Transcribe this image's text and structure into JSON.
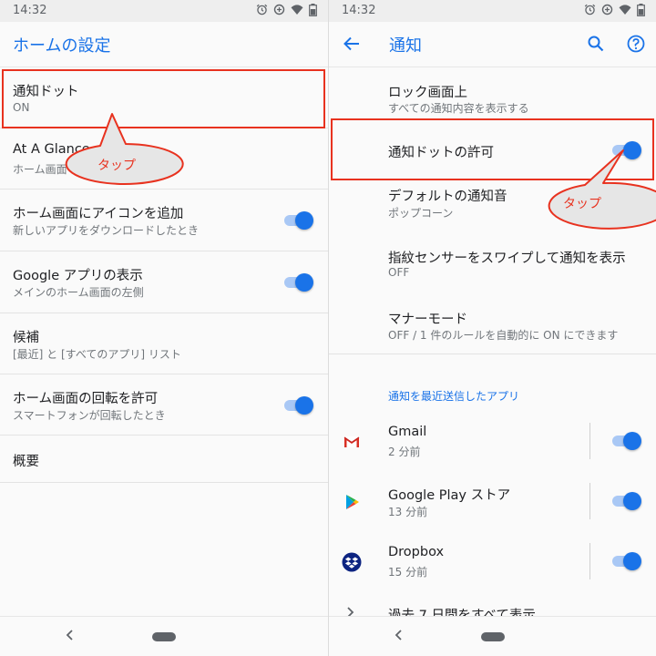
{
  "status": {
    "time": "14:32"
  },
  "left": {
    "title": "ホームの設定",
    "items": [
      {
        "title": "通知ドット",
        "subtitle": "ON"
      },
      {
        "title": "At A Glance",
        "subtitle": "ホーム画面"
      },
      {
        "title": "ホーム画面にアイコンを追加",
        "subtitle": "新しいアプリをダウンロードしたとき",
        "toggle": true
      },
      {
        "title": "Google アプリの表示",
        "subtitle": "メインのホーム画面の左側",
        "toggle": true
      },
      {
        "title": "候補",
        "subtitle": "[最近] と [すべてのアプリ] リスト"
      },
      {
        "title": "ホーム画面の回転を許可",
        "subtitle": "スマートフォンが回転したとき",
        "toggle": true
      },
      {
        "title": "概要"
      }
    ],
    "callout": "タップ"
  },
  "right": {
    "title": "通知",
    "items": [
      {
        "title": "ロック画面上",
        "subtitle": "すべての通知内容を表示する"
      },
      {
        "title": "通知ドットの許可",
        "toggle": true
      },
      {
        "title": "デフォルトの通知音",
        "subtitle": "ポップコーン"
      },
      {
        "title": "指紋センサーをスワイプして通知を表示",
        "subtitle": "OFF"
      },
      {
        "title": "マナーモード",
        "subtitle": "OFF / 1 件のルールを自動的に ON にできます"
      }
    ],
    "section_header": "通知を最近送信したアプリ",
    "apps": [
      {
        "name": "Gmail",
        "time": "2 分前",
        "icon": "gmail-icon",
        "toggle": true
      },
      {
        "name": "Google Play ストア",
        "time": "13 分前",
        "icon": "play-store-icon",
        "toggle": true
      },
      {
        "name": "Dropbox",
        "time": "15 分前",
        "icon": "dropbox-icon",
        "toggle": true
      }
    ],
    "see_all": "過去 7 日間をすべて表示",
    "callout": "タップ"
  },
  "colors": {
    "accent": "#1a73e8",
    "highlight": "#e8321f",
    "bubble": "#e6e6e6"
  }
}
